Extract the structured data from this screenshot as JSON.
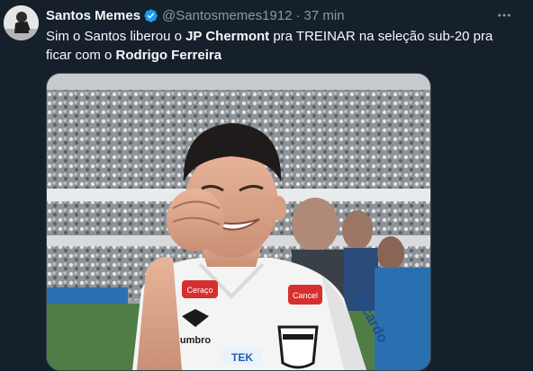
{
  "tweet": {
    "author_name": "Santos Memes",
    "handle": "@Santosmemes1912",
    "separator": "·",
    "time": "37 min",
    "verified_icon": "verified-badge-icon",
    "more_icon": "more-options-icon",
    "text_parts": {
      "p1": "Sim o Santos liberou o ",
      "p2": "JP Chermont",
      "p3": " pra TREINAR na seleção sub-20 pra ficar com o ",
      "p4": "Rodrigo Ferreira"
    },
    "media": {
      "sponsor_left": "Ceraço",
      "sponsor_right": "Cancel",
      "brand": "umbro",
      "sleeve_text": "Ricardo",
      "chest_text": "TEK"
    }
  },
  "colors": {
    "background": "#15202b",
    "text_primary": "#f7f9f9",
    "text_secondary": "#8b98a5",
    "verified": "#1d9bf0"
  }
}
